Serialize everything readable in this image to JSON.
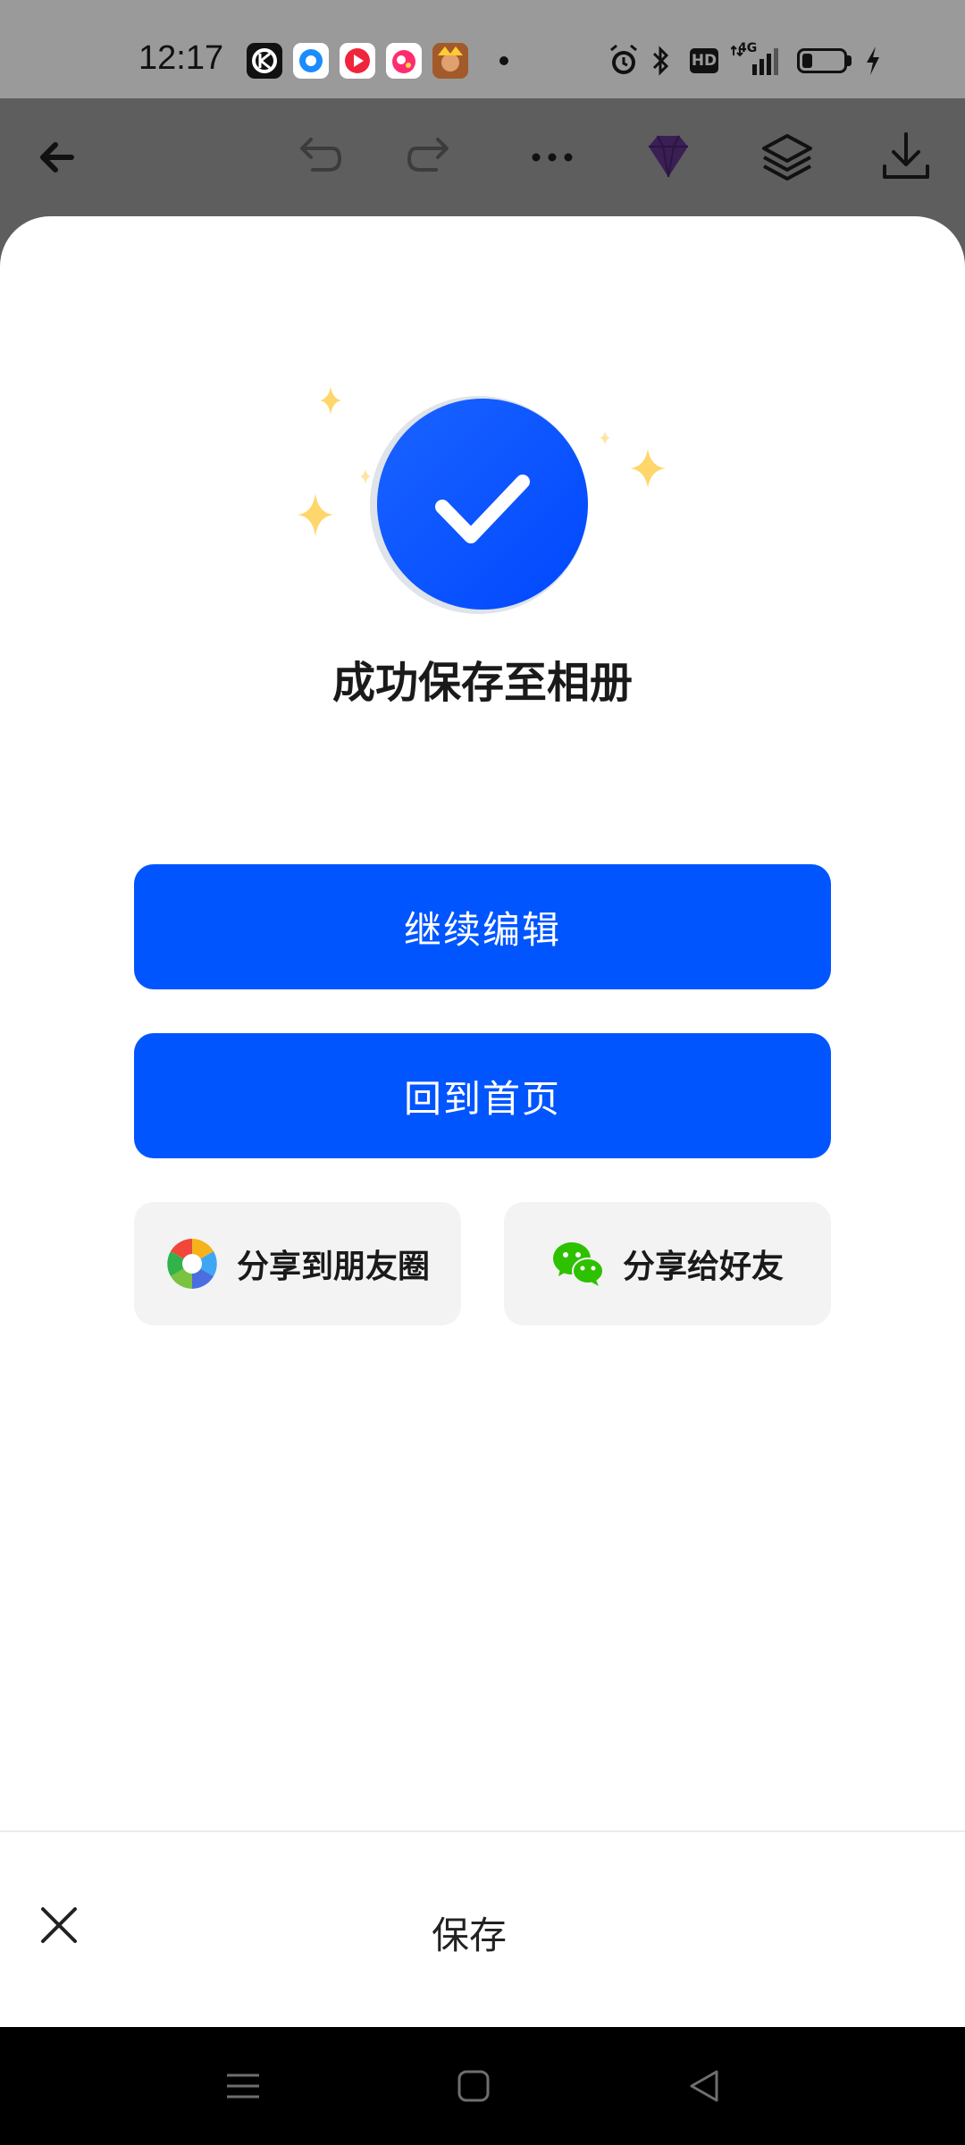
{
  "status_bar": {
    "time": "12:17",
    "notification_icons": [
      "kwai-app-icon",
      "message-app-icon",
      "video-app-icon",
      "qq-music-app-icon",
      "game-avatar-app-icon"
    ],
    "right_icons": [
      "alarm-icon",
      "bluetooth-icon",
      "hd-icon",
      "4g-signal-icon",
      "battery-icon",
      "charging-icon"
    ],
    "hd_label": "HD",
    "network_label": "4G",
    "battery_level_percent": 25
  },
  "toolbar": {
    "icons": [
      "back-arrow-icon",
      "undo-icon",
      "redo-icon",
      "more-icon",
      "premium-diamond-icon",
      "layers-icon",
      "download-icon"
    ]
  },
  "success": {
    "title": "成功保存至相册"
  },
  "buttons": {
    "continue_edit": "继续编辑",
    "back_home": "回到首页",
    "share_moments": "分享到朋友圈",
    "share_friend": "分享给好友"
  },
  "bottom_bar": {
    "title": "保存"
  },
  "colors": {
    "primary": "#0055ff",
    "wechat_green": "#2dc100",
    "sparkle": "#ffd66b",
    "overlay": "#5e5e5e"
  }
}
